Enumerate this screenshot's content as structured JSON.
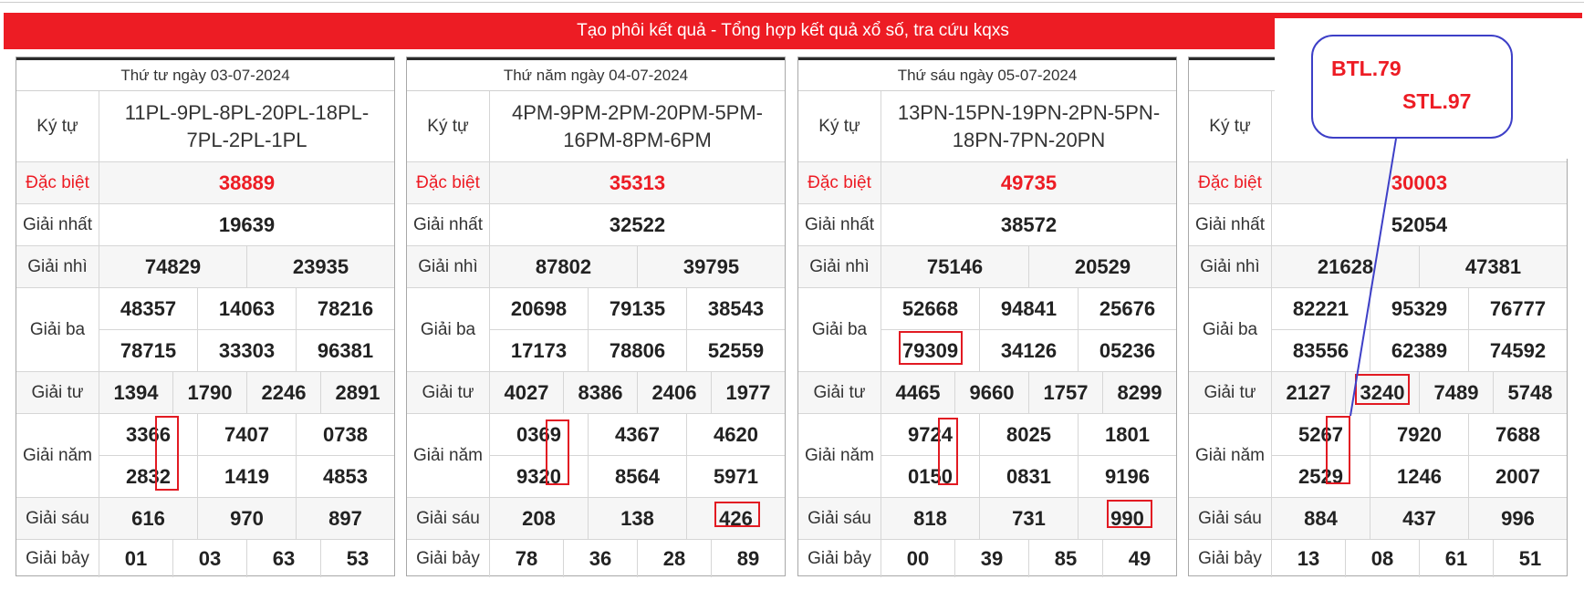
{
  "banner": {
    "title": "Tạo phôi kết quả - Tổng hợp kết quả xổ số, tra cứu kqxs"
  },
  "labels": {
    "kytu": "Ký tự",
    "db": "Đặc biệt",
    "g1": "Giải nhất",
    "g2": "Giải nhì",
    "g3": "Giải ba",
    "g4": "Giải tư",
    "g5": "Giải năm",
    "g6": "Giải sáu",
    "g7": "Giải bảy"
  },
  "colors": {
    "accent": "#ed1c24",
    "annotation_box": "#e21a22",
    "annotation_line": "#3d3fc7"
  },
  "note": {
    "btl": "BTL.79",
    "stl": "STL.97"
  },
  "panels": [
    {
      "date": "Thứ tư ngày 03-07-2024",
      "kytu": "11PL-9PL-8PL-20PL-18PL-7PL-2PL-1PL",
      "db": "38889",
      "g1": "19639",
      "g2": [
        "74829",
        "23935"
      ],
      "g3": [
        "48357",
        "14063",
        "78216",
        "78715",
        "33303",
        "96381"
      ],
      "g4": [
        "1394",
        "1790",
        "2246",
        "2891"
      ],
      "g5": [
        "3366",
        "7407",
        "0738",
        "2832",
        "1419",
        "4853"
      ],
      "g6": [
        "616",
        "970",
        "897"
      ],
      "g7": [
        "01",
        "03",
        "63",
        "53"
      ]
    },
    {
      "date": "Thứ năm ngày 04-07-2024",
      "kytu": "4PM-9PM-2PM-20PM-5PM-16PM-8PM-6PM",
      "db": "35313",
      "g1": "32522",
      "g2": [
        "87802",
        "39795"
      ],
      "g3": [
        "20698",
        "79135",
        "38543",
        "17173",
        "78806",
        "52559"
      ],
      "g4": [
        "4027",
        "8386",
        "2406",
        "1977"
      ],
      "g5": [
        "0369",
        "4367",
        "4620",
        "9320",
        "8564",
        "5971"
      ],
      "g6": [
        "208",
        "138",
        "426"
      ],
      "g7": [
        "78",
        "36",
        "28",
        "89"
      ]
    },
    {
      "date": "Thứ sáu ngày 05-07-2024",
      "kytu": "13PN-15PN-19PN-2PN-5PN-18PN-7PN-20PN",
      "db": "49735",
      "g1": "38572",
      "g2": [
        "75146",
        "20529"
      ],
      "g3": [
        "52668",
        "94841",
        "25676",
        "79309",
        "34126",
        "05236"
      ],
      "g4": [
        "4465",
        "9660",
        "1757",
        "8299"
      ],
      "g5": [
        "9724",
        "8025",
        "1801",
        "0150",
        "0831",
        "9196"
      ],
      "g6": [
        "818",
        "731",
        "990"
      ],
      "g7": [
        "00",
        "39",
        "85",
        "49"
      ]
    },
    {
      "date": "",
      "kytu": "",
      "db": "30003",
      "g1": "52054",
      "g2": [
        "21628",
        "47381"
      ],
      "g3": [
        "82221",
        "95329",
        "76777",
        "83556",
        "62389",
        "74592"
      ],
      "g4": [
        "2127",
        "3240",
        "7489",
        "5748"
      ],
      "g5": [
        "5267",
        "7920",
        "7688",
        "2529",
        "1246",
        "2007"
      ],
      "g6": [
        "884",
        "437",
        "996"
      ],
      "g7": [
        "13",
        "08",
        "61",
        "51"
      ]
    }
  ]
}
